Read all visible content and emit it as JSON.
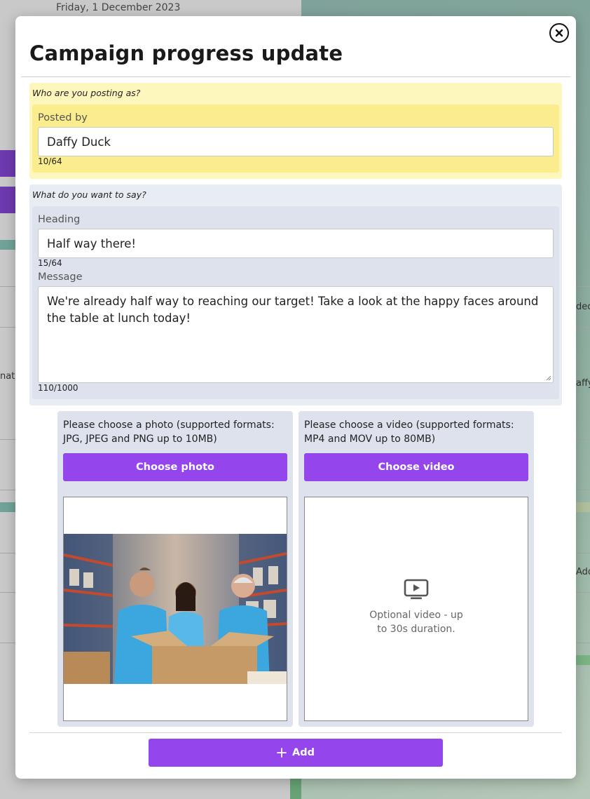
{
  "background": {
    "date": "Friday, 1 December 2023",
    "fragments": [
      "ded",
      "nati",
      "affy",
      "Add"
    ]
  },
  "modal": {
    "title": "Campaign progress update",
    "close_icon": "close-circle-icon"
  },
  "posted_section": {
    "question": "Who are you posting as?",
    "label": "Posted by",
    "value": "Daffy Duck",
    "counter": "10/64"
  },
  "say_section": {
    "question": "What do you want to say?",
    "heading_label": "Heading",
    "heading_value": "Half way there!",
    "heading_counter": "15/64",
    "message_label": "Message",
    "message_value": "We're already half way to reaching our target! Take a look at the happy faces around the table at lunch today!",
    "message_counter": "110/1000"
  },
  "photo": {
    "description": "Please choose a photo (supported formats: JPG, JPEG and PNG up to 10MB)",
    "button_label": "Choose photo"
  },
  "video": {
    "description": "Please choose a video (supported formats: MP4 and MOV up to 80MB)",
    "button_label": "Choose video",
    "placeholder_icon": "video-play-icon",
    "placeholder_text": "Optional video - up to 30s duration."
  },
  "footer": {
    "add_label": "Add",
    "add_icon": "plus-icon"
  },
  "colors": {
    "accent": "#9446ec",
    "posted_bg": "#fdf6bd",
    "posted_inner": "#fbec8e",
    "section_bg": "#e8ecf3",
    "section_inner": "#dde2ec"
  }
}
